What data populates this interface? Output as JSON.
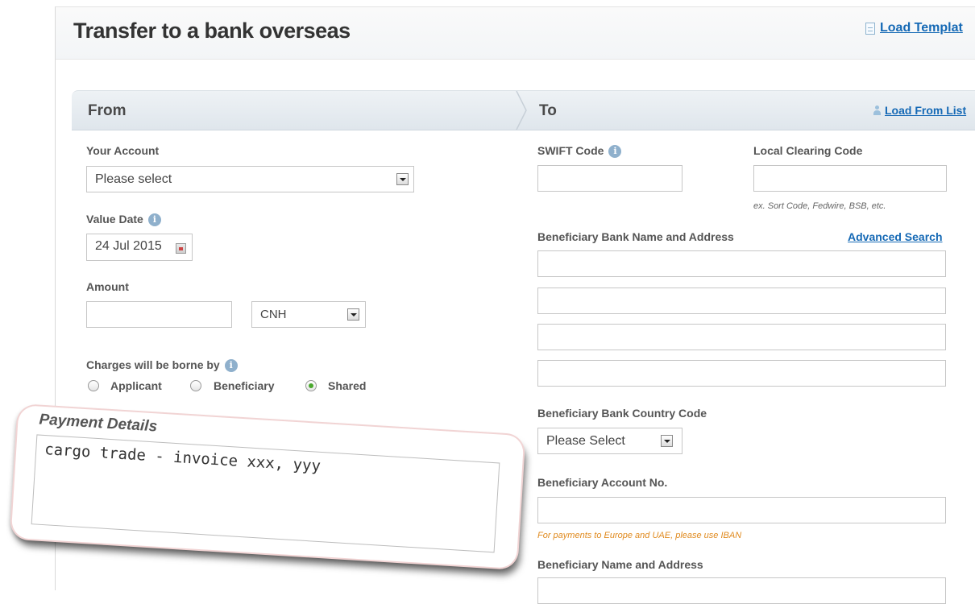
{
  "header": {
    "title": "Transfer to a bank overseas",
    "load_template": "Load Templat"
  },
  "from": {
    "title": "From",
    "your_account": {
      "label": "Your Account",
      "value": "Please select"
    },
    "value_date": {
      "label": "Value Date",
      "value": "24 Jul 2015"
    },
    "amount": {
      "label": "Amount",
      "value": "",
      "currency": "CNH"
    },
    "charges": {
      "label": "Charges will be borne by",
      "options": [
        "Applicant",
        "Beneficiary",
        "Shared"
      ],
      "selected": "Shared"
    }
  },
  "to": {
    "title": "To",
    "load_from_list": "Load From List",
    "swift_code": {
      "label": "SWIFT Code",
      "value": ""
    },
    "local_clearing": {
      "label": "Local Clearing Code",
      "value": "",
      "hint": "ex. Sort Code, Fedwire, BSB, etc."
    },
    "bank_name_address": {
      "label": "Beneficiary Bank Name and Address",
      "advanced_search": "Advanced Search",
      "lines": [
        "",
        "",
        "",
        ""
      ]
    },
    "bank_country": {
      "label": "Beneficiary Bank Country Code",
      "value": "Please Select"
    },
    "account_no": {
      "label": "Beneficiary Account No.",
      "value": "",
      "hint": "For payments to Europe and UAE, please use IBAN"
    },
    "name_address": {
      "label": "Beneficiary Name and Address"
    }
  },
  "payment_details": {
    "label": "Payment Details",
    "value": "cargo trade - invoice xxx, yyy"
  },
  "icons": {
    "info": "info-icon",
    "calendar": "calendar-icon",
    "document": "document-icon",
    "person": "person-icon"
  },
  "colors": {
    "link": "#1569b5",
    "radio_selected": "#4aa82e",
    "hint_orange": "#e08a1e"
  }
}
